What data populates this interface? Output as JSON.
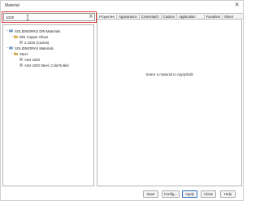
{
  "window": {
    "title": "Material",
    "close_glyph": "✕"
  },
  "search": {
    "value": "1020",
    "clear_glyph": "X"
  },
  "tree": [
    {
      "id": "lib-din",
      "label": "SOLIDWORKS DIN Materials",
      "icon": "library-icon",
      "toggle": "−"
    },
    {
      "id": "cat-din-copper",
      "label": "DIN Copper Alloys",
      "icon": "folder-icon",
      "toggle": "−"
    },
    {
      "id": "mat-din-1",
      "label": "2.1020 (CuSn6)",
      "icon": "material-icon",
      "toggle": ""
    },
    {
      "id": "lib-sw",
      "label": "SOLIDWORKS Materials",
      "icon": "library-icon",
      "toggle": "−"
    },
    {
      "id": "cat-steel",
      "label": "Steel",
      "icon": "folder-icon",
      "toggle": "−"
    },
    {
      "id": "mat-aisi-1020",
      "label": "AISI 1020",
      "icon": "material-icon",
      "toggle": ""
    },
    {
      "id": "mat-aisi-1020-cr",
      "label": "AISI 1020 Steel, Cold Rolled",
      "icon": "material-icon",
      "toggle": ""
    }
  ],
  "tabs": [
    "Properties",
    "Appearance",
    "CrossHatch",
    "Custom",
    "Application Data",
    "Favorites",
    "Sheet Metal"
  ],
  "content": {
    "hint": "Select a material to Apply/Edit"
  },
  "buttons": {
    "save": "Save",
    "config": "Config...",
    "apply": "Apply",
    "close": "Close",
    "help": "Help"
  },
  "colors": {
    "highlight": "#d83b3b",
    "folder": "#e0b24a",
    "library": "#4a7bb8",
    "primary_border": "#2f6fbe"
  }
}
